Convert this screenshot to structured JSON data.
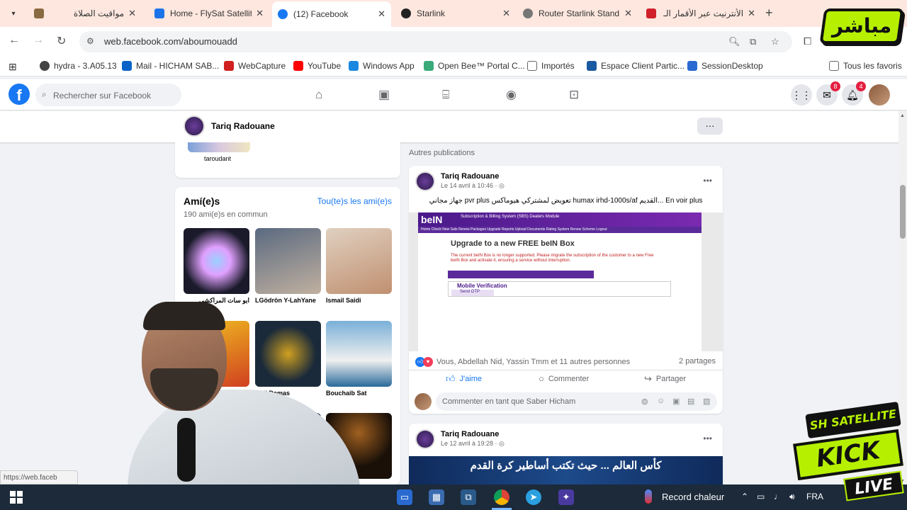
{
  "browser": {
    "tabs": [
      {
        "title": "مواقيت الصلاة",
        "favicon_color": "#8a6a40"
      },
      {
        "title": "Home - FlySat Satellit",
        "favicon_color": "#1a73e8"
      },
      {
        "title": "(12) Facebook",
        "favicon_color": "#1877f2",
        "active": true
      },
      {
        "title": "Starlink",
        "favicon_color": "#222222"
      },
      {
        "title": "Router Starlink Stand",
        "favicon_color": "#555555"
      },
      {
        "title": "الأنترنيت عبر الأقمار الـ",
        "favicon_color": "#d0202a"
      }
    ],
    "tab_menu_icon": "chevron-down-icon",
    "new_tab_label": "+",
    "address": "web.facebook.com/aboumouadd",
    "bookmarks": [
      {
        "label": "hydra - 3.A05.13",
        "icon_color": "#444444"
      },
      {
        "label": "Mail - HICHAM SAB...",
        "icon_color": "#0a64c8"
      },
      {
        "label": "WebCapture",
        "icon_color": "#d02020"
      },
      {
        "label": "YouTube",
        "icon_color": "#ff0000"
      },
      {
        "label": "Windows App",
        "icon_color": "#1a88e0"
      },
      {
        "label": "Open Bee™ Portal C...",
        "icon_color": "#3aaa7a"
      },
      {
        "label": "Importés",
        "icon_color": "#666666"
      },
      {
        "label": "Espace Client Partic...",
        "icon_color": "#1a5aa0"
      },
      {
        "label": "SessionDesktop",
        "icon_color": "#2a6ad0"
      }
    ],
    "all_bookmarks_label": "Tous les favoris"
  },
  "facebook": {
    "logo_letter": "f",
    "search_placeholder": "Rechercher sur Facebook",
    "messenger_badge": "8",
    "notifications_badge": "4",
    "profile_name": "Tariq Radouane",
    "more_label": "···",
    "photo_caption": "taroudant",
    "friends": {
      "title": "Amí(e)s",
      "see_all": "Tou(te)s les ami(e)s",
      "common": "190 ami(e)s en commun",
      "list": [
        {
          "name": "ابو سات المراكشي",
          "color1": "#1a1a2a",
          "color2": "#9ad0ff"
        },
        {
          "name": "LGödrön Y-LahYane",
          "color1": "#5a6a80",
          "color2": "#c0b0a0"
        },
        {
          "name": "Ismail Saidi",
          "color1": "#c09070",
          "color2": "#e0d0c0"
        },
        {
          "name": "",
          "color1": "#d04020",
          "color2": "#f0c020"
        },
        {
          "name": "Adil Damas",
          "color1": "#1a2a3a",
          "color2": "#d0a020"
        },
        {
          "name": "Bouchaib Sat",
          "color1": "#2a6a9a",
          "color2": "#f0f0f0"
        },
        {
          "name": "",
          "color1": "#101820",
          "color2": "#2a3a50"
        },
        {
          "name": "",
          "color1": "#1a1008",
          "color2": "#a06020"
        }
      ]
    },
    "other_posts_label": "Autres publications",
    "posts": [
      {
        "author": "Tariq Radouane",
        "date": "Le 14 avril à 10:46 · ◎",
        "text": "جهاز مجاني pvr plus تعويض لمشتركي هيوماكس humax irhd-1000s/af القديم... En voir plus",
        "image": {
          "logo": "beIN",
          "header_sub": "Subscription & Billing System (SBS) Dealers Module",
          "menu": "Home  Check  New Sale  Renew  Packages  Upgrade  Reports  Upload Documents  Rating System  Renew Scheme  Logout",
          "heading": "Upgrade to a new FREE beIN Box",
          "notice": "The current beIN Box is no longer supported. Please migrate the subscription of the customer to a new Free beIN Box and activate it, ensuring a service without interruption.",
          "mobile_verification": "Mobile Verification",
          "send_otp": "Send OTP"
        },
        "reactions": "Vous, Abdellah Nid, Yassin Tmm et 11 autres personnes",
        "shares": "2 partages",
        "actions": {
          "like": "J'aime",
          "comment": "Commenter",
          "share": "Partager"
        },
        "comment_placeholder": "Commenter en tant que Saber Hicham"
      },
      {
        "author": "Tariq Radouane",
        "date": "Le 12 avril à 19:28 · ◎",
        "banner": "كأس العالم ... حيث تكتب أساطير كرة القدم"
      }
    ]
  },
  "status_url": "https://web.faceb",
  "taskbar": {
    "weather": "Record chaleur",
    "language": "FRA"
  },
  "overlays": {
    "top_logo": "مباشر",
    "channel_tag": "SH SATELLITE",
    "kick": "KICK",
    "live": "LIVE",
    "brand_color": "#b6f000"
  }
}
